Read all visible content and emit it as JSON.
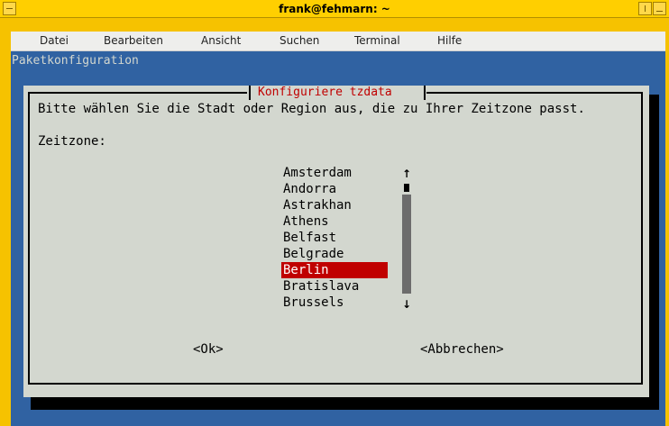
{
  "window": {
    "title": "frank@fehmarn: ~"
  },
  "menubar": {
    "items": [
      "Datei",
      "Bearbeiten",
      "Ansicht",
      "Suchen",
      "Terminal",
      "Hilfe"
    ]
  },
  "terminal": {
    "header": "Paketkonfiguration"
  },
  "dialog": {
    "title": "Konfiguriere tzdata",
    "prompt": "Bitte wählen Sie die Stadt oder Region aus, die zu Ihrer Zeitzone passt.",
    "field_label": "Zeitzone:",
    "timezones": [
      "Amsterdam",
      "Andorra",
      "Astrakhan",
      "Athens",
      "Belfast",
      "Belgrade",
      "Berlin",
      "Bratislava",
      "Brussels"
    ],
    "selected": "Berlin",
    "ok_label": "<Ok>",
    "cancel_label": "<Abbrechen>",
    "scroll_up_glyph": "↑",
    "scroll_down_glyph": "↓"
  },
  "colors": {
    "title_bar": "#ffcf00",
    "terminal_bg": "#3062a2",
    "dialog_bg": "#d3d7cf",
    "accent": "#c00000"
  }
}
